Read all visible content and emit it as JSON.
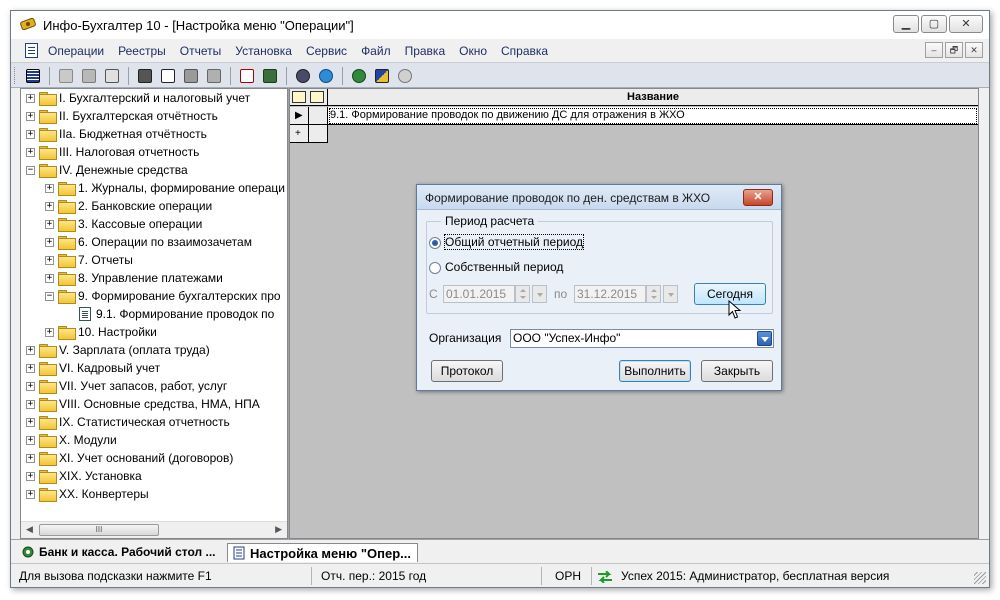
{
  "window": {
    "title": "Инфо-Бухгалтер 10 - [Настройка меню \"Операции\"]",
    "controls": {
      "minimize": "▁",
      "maximize": "▢",
      "close": "✕"
    }
  },
  "menubar": {
    "items": [
      "Операции",
      "Реестры",
      "Отчеты",
      "Установка",
      "Сервис",
      "Файл",
      "Правка",
      "Окно",
      "Справка"
    ],
    "mdi_controls": [
      "–",
      "🗗",
      "✕"
    ]
  },
  "toolbar": {
    "icons": [
      "grid-icon",
      "copy-icon",
      "paste-icon",
      "cut-icon",
      "print-icon",
      "preview-icon",
      "image-icon",
      "settings-doc-icon",
      "report-icon",
      "calculator-icon",
      "tools-icon",
      "refresh-icon",
      "gear-icon",
      "palette-icon",
      "network-icon"
    ]
  },
  "tree": {
    "items": [
      {
        "label": "I. Бухгалтерский и налоговый учет",
        "level": 0,
        "type": "folder",
        "expander": "+"
      },
      {
        "label": "II. Бухгалтерская отчётность",
        "level": 0,
        "type": "folder",
        "expander": "+"
      },
      {
        "label": "IIa. Бюджетная отчётность",
        "level": 0,
        "type": "folder",
        "expander": "+"
      },
      {
        "label": "III. Налоговая отчетность",
        "level": 0,
        "type": "folder",
        "expander": "+"
      },
      {
        "label": "IV. Денежные средства",
        "level": 0,
        "type": "folder",
        "expander": "−"
      },
      {
        "label": "1. Журналы, формирование операци",
        "level": 1,
        "type": "folder",
        "expander": "+"
      },
      {
        "label": "2. Банковские операции",
        "level": 1,
        "type": "folder",
        "expander": "+"
      },
      {
        "label": "3. Кассовые операции",
        "level": 1,
        "type": "folder",
        "expander": "+"
      },
      {
        "label": "6. Операции по взаимозачетам",
        "level": 1,
        "type": "folder",
        "expander": "+"
      },
      {
        "label": "7. Отчеты",
        "level": 1,
        "type": "folder",
        "expander": "+"
      },
      {
        "label": "8. Управление платежами",
        "level": 1,
        "type": "folder",
        "expander": "+"
      },
      {
        "label": "9. Формирование бухгалтерских про",
        "level": 1,
        "type": "folder",
        "expander": "−"
      },
      {
        "label": "9.1. Формирование проводок по",
        "level": 2,
        "type": "doc",
        "expander": ""
      },
      {
        "label": "10. Настройки",
        "level": 1,
        "type": "folder",
        "expander": "+"
      },
      {
        "label": "V. Зарплата (оплата труда)",
        "level": 0,
        "type": "folder",
        "expander": "+"
      },
      {
        "label": "VI. Кадровый учет",
        "level": 0,
        "type": "folder",
        "expander": "+"
      },
      {
        "label": "VII. Учет запасов, работ, услуг",
        "level": 0,
        "type": "folder",
        "expander": "+"
      },
      {
        "label": "VIII. Основные средства, НМА, НПА",
        "level": 0,
        "type": "folder",
        "expander": "+"
      },
      {
        "label": "IX. Статистическая отчетность",
        "level": 0,
        "type": "folder",
        "expander": "+"
      },
      {
        "label": "X. Модули",
        "level": 0,
        "type": "folder",
        "expander": "+"
      },
      {
        "label": "XI. Учет оснований (договоров)",
        "level": 0,
        "type": "folder",
        "expander": "+"
      },
      {
        "label": "XIX. Установка",
        "level": 0,
        "type": "folder",
        "expander": "+"
      },
      {
        "label": "XX. Конвертеры",
        "level": 0,
        "type": "folder",
        "expander": "+"
      }
    ],
    "scroll_thumb_glyph": "III"
  },
  "grid": {
    "column_header": "Название",
    "rows": [
      {
        "indicator": "▶",
        "name": "9.1. Формирование проводок по движению ДС для отражения в ЖХО"
      },
      {
        "indicator": "+",
        "name": ""
      }
    ]
  },
  "dialog": {
    "title": "Формирование проводок по ден. средствам в ЖХО",
    "close_glyph": "✕",
    "period_group_label": "Период расчета",
    "radio_common": "Общий отчетный период",
    "radio_own": "Собственный период",
    "from_label": "С",
    "from_date": "01.01.2015",
    "to_label": "по",
    "to_date": "31.12.2015",
    "today_button": "Сегодня",
    "org_label": "Организация",
    "org_value": "ООО \"Успех-Инфо\"",
    "protocol_button": "Протокол",
    "execute_button": "Выполнить",
    "close_button": "Закрыть"
  },
  "tabs": [
    {
      "label": "Банк и касса. Рабочий стол ...",
      "active": false
    },
    {
      "label": "Настройка меню \"Опер...",
      "active": true
    }
  ],
  "status": {
    "hint": "Для вызова подсказки нажмите F1",
    "period": "Отч. пер.: 2015 год",
    "indicator": "ОРН",
    "connection": "Успех 2015: Администратор, бесплатная версия"
  },
  "colors": {
    "accent": "#2a5db0",
    "folder": "#f3c531",
    "grid_background": "#c0c0c0",
    "toolbar_background": "#dfe4ec"
  }
}
